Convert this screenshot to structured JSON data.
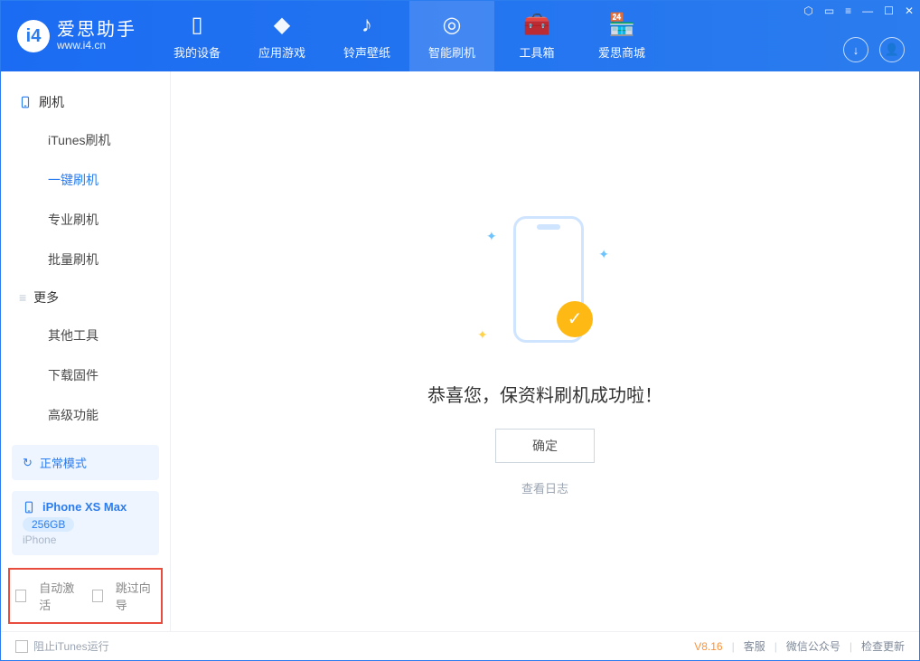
{
  "app": {
    "logo_title": "爱思助手",
    "logo_sub": "www.i4.cn"
  },
  "nav": {
    "tabs": [
      {
        "label": "我的设备",
        "icon": "device-icon"
      },
      {
        "label": "应用游戏",
        "icon": "cube-icon"
      },
      {
        "label": "铃声壁纸",
        "icon": "music-icon"
      },
      {
        "label": "智能刷机",
        "icon": "shield-icon"
      },
      {
        "label": "工具箱",
        "icon": "toolbox-icon"
      },
      {
        "label": "爱思商城",
        "icon": "store-icon"
      }
    ],
    "active_index": 3
  },
  "sidebar": {
    "section1_title": "刷机",
    "items1": [
      {
        "label": "iTunes刷机"
      },
      {
        "label": "一键刷机"
      },
      {
        "label": "专业刷机"
      },
      {
        "label": "批量刷机"
      }
    ],
    "active1_index": 1,
    "section2_title": "更多",
    "items2": [
      {
        "label": "其他工具"
      },
      {
        "label": "下载固件"
      },
      {
        "label": "高级功能"
      }
    ],
    "mode_label": "正常模式",
    "device": {
      "name": "iPhone XS Max",
      "capacity": "256GB",
      "type": "iPhone"
    },
    "bottom": {
      "auto_activate": "自动激活",
      "skip_wizard": "跳过向导"
    }
  },
  "main": {
    "success_text": "恭喜您，保资料刷机成功啦！",
    "ok_label": "确定",
    "log_link": "查看日志"
  },
  "footer": {
    "stop_itunes": "阻止iTunes运行",
    "version": "V8.16",
    "links": [
      "客服",
      "微信公众号",
      "检查更新"
    ]
  }
}
